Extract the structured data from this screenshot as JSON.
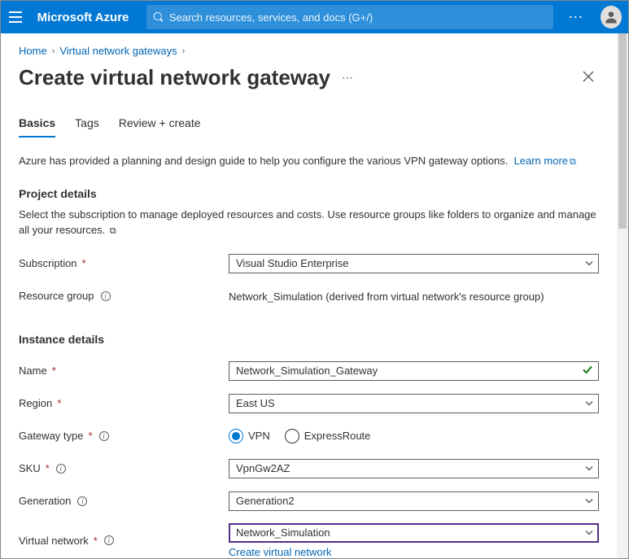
{
  "header": {
    "brand": "Microsoft Azure",
    "search_placeholder": "Search resources, services, and docs (G+/)"
  },
  "breadcrumb": {
    "items": [
      "Home",
      "Virtual network gateways"
    ]
  },
  "page": {
    "title": "Create virtual network gateway"
  },
  "tabs": [
    {
      "label": "Basics",
      "active": true
    },
    {
      "label": "Tags",
      "active": false
    },
    {
      "label": "Review + create",
      "active": false
    }
  ],
  "intro": {
    "text": "Azure has provided a planning and design guide to help you configure the various VPN gateway options.",
    "learn_more": "Learn more"
  },
  "project_details": {
    "heading": "Project details",
    "desc": "Select the subscription to manage deployed resources and costs. Use resource groups like folders to organize and manage all your resources.",
    "subscription_label": "Subscription",
    "subscription_value": "Visual Studio Enterprise",
    "resource_group_label": "Resource group",
    "resource_group_value": "Network_Simulation (derived from virtual network's resource group)"
  },
  "instance_details": {
    "heading": "Instance details",
    "name_label": "Name",
    "name_value": "Network_Simulation_Gateway",
    "region_label": "Region",
    "region_value": "East US",
    "gateway_type_label": "Gateway type",
    "gateway_type_options": [
      "VPN",
      "ExpressRoute"
    ],
    "gateway_type_selected": "VPN",
    "sku_label": "SKU",
    "sku_value": "VpnGw2AZ",
    "generation_label": "Generation",
    "generation_value": "Generation2",
    "vnet_label": "Virtual network",
    "vnet_value": "Network_Simulation",
    "create_vnet_link": "Create virtual network"
  }
}
